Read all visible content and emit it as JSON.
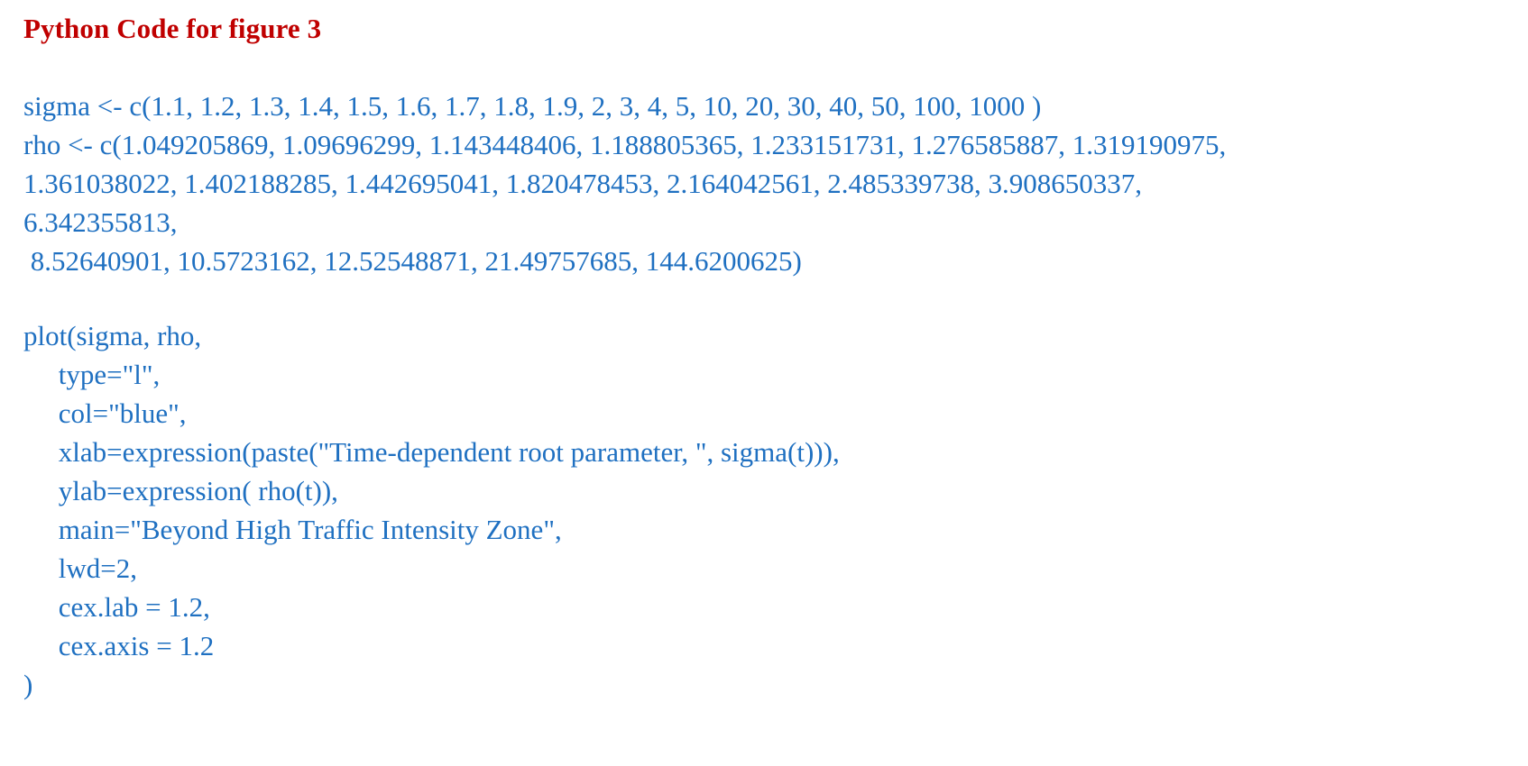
{
  "document": {
    "heading": "Python Code for figure 3",
    "code": {
      "sigma_assignment": "sigma <- c(1.1, 1.2, 1.3, 1.4, 1.5, 1.6, 1.7, 1.8, 1.9, 2, 3, 4, 5, 10, 20, 30, 40, 50, 100, 1000 )",
      "rho_assignment_lines": [
        "rho <- c(1.049205869, 1.09696299, 1.143448406, 1.188805365, 1.233151731, 1.276585887, 1.319190975,",
        "1.361038022, 1.402188285, 1.442695041, 1.820478453, 2.164042561, 2.485339738, 3.908650337,",
        "6.342355813,",
        " 8.52640901, 10.5723162, 12.52548871, 21.49757685, 144.6200625)"
      ],
      "plot_call_lines": [
        "plot(sigma, rho,",
        "     type=\"l\",",
        "     col=\"blue\",",
        "     xlab=expression(paste(\"Time-dependent root parameter, \", sigma(t))),",
        "     ylab=expression( rho(t)),",
        "     main=\"Beyond High Traffic Intensity Zone\",",
        "     lwd=2,",
        "     cex.lab = 1.2,",
        "     cex.axis = 1.2",
        ")"
      ]
    },
    "colors": {
      "heading": "#c00000",
      "code": "#1f70c1",
      "background": "#ffffff"
    }
  },
  "chart_data": {
    "type": "line",
    "title": "Beyond High Traffic Intensity Zone",
    "xlabel": "Time-dependent root parameter, sigma(t)",
    "ylabel": "rho(t)",
    "x": [
      1.1,
      1.2,
      1.3,
      1.4,
      1.5,
      1.6,
      1.7,
      1.8,
      1.9,
      2,
      3,
      4,
      5,
      10,
      20,
      30,
      40,
      50,
      100,
      1000
    ],
    "y": [
      1.049205869,
      1.09696299,
      1.143448406,
      1.188805365,
      1.233151731,
      1.276585887,
      1.319190975,
      1.361038022,
      1.402188285,
      1.442695041,
      1.820478453,
      2.164042561,
      2.485339738,
      3.908650337,
      6.342355813,
      8.52640901,
      10.5723162,
      12.52548871,
      21.49757685,
      144.6200625
    ],
    "series": [
      {
        "name": "rho",
        "values": [
          1.049205869,
          1.09696299,
          1.143448406,
          1.188805365,
          1.233151731,
          1.276585887,
          1.319190975,
          1.361038022,
          1.402188285,
          1.442695041,
          1.820478453,
          2.164042561,
          2.485339738,
          3.908650337,
          6.342355813,
          8.52640901,
          10.5723162,
          12.52548871,
          21.49757685,
          144.6200625
        ]
      }
    ],
    "line_color": "blue",
    "line_width": 2,
    "cex_lab": 1.2,
    "cex_axis": 1.2
  }
}
